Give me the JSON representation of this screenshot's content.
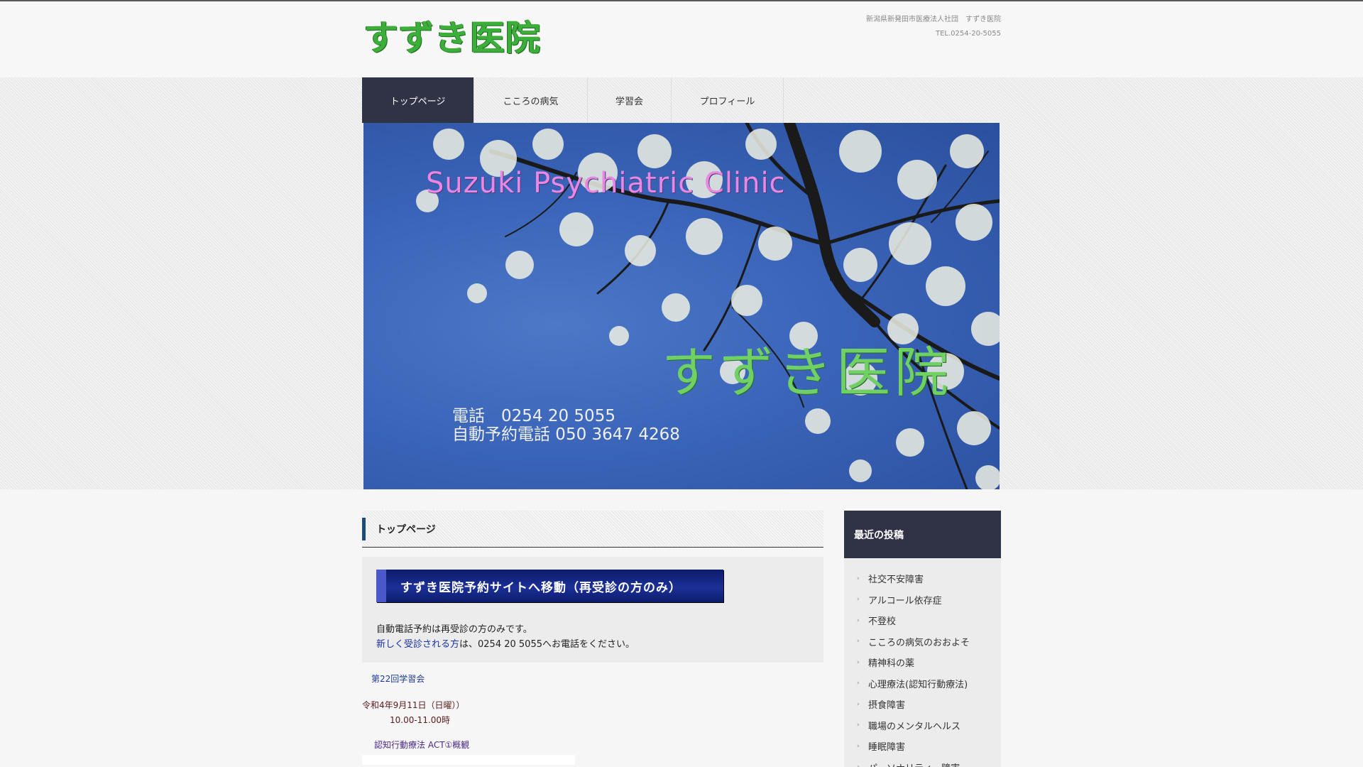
{
  "header": {
    "logo": "すずき医院",
    "address_line": "新潟県新発田市医療法人社団　すずき医院",
    "tel_line": "TEL.0254-20-5055"
  },
  "nav": {
    "items": [
      {
        "label": "トップページ",
        "active": true
      },
      {
        "label": "こころの病気",
        "active": false
      },
      {
        "label": "学習会",
        "active": false
      },
      {
        "label": "プロフィール",
        "active": false
      }
    ]
  },
  "hero": {
    "title_en": "Suzuki Psychiatric Clinic",
    "title_jp": "すずき医院",
    "tel_line1": "電話　0254 20 5055",
    "tel_line2": "自動予約電話 050 3647 4268"
  },
  "main": {
    "page_title": "トップページ",
    "banner_label": "すずき医院予約サイトへ移動（再受診の方のみ）",
    "note_line1": "自動電話予約は再受診の方のみです。",
    "note_link": "新しく受診される方",
    "note_line2_rest": "は、0254 20 5055へお電話をください。",
    "study_title": "第22回学習会",
    "study_date": "令和4年9月11日（日曜））",
    "study_time": "10.00-11.00時",
    "study_topic": "認知行動療法 ACT①概観"
  },
  "sidebar": {
    "heading": "最近の投稿",
    "items": [
      "社交不安障害",
      "アルコール依存症",
      "不登校",
      "こころの病気のおおよそ",
      "精神科の薬",
      "心理療法(認知行動療法)",
      "摂食障害",
      "職場のメンタルヘルス",
      "睡眠障害",
      "パーソナリティー障害"
    ]
  },
  "colors": {
    "nav_active": "#2f3345",
    "logo_green": "#3cae3a",
    "banner_blue": "#1b2f98",
    "link_blue": "#1a2fa8"
  }
}
